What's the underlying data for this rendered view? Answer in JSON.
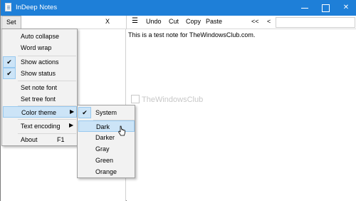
{
  "window": {
    "title": "InDeep Notes"
  },
  "toolbar": {
    "set_label": "Set",
    "close_tree_label": "X",
    "menu_icon": "hamburger-icon",
    "undo_label": "Undo",
    "cut_label": "Cut",
    "copy_label": "Copy",
    "paste_label": "Paste",
    "back2_label": "<<",
    "back_label": "<"
  },
  "note": {
    "text": "This is a test note for TheWindowsClub.com."
  },
  "watermark": {
    "text": "TheWindowsClub"
  },
  "menu": {
    "items": [
      {
        "label": "Auto collapse",
        "checked": false
      },
      {
        "label": "Word wrap",
        "checked": false
      },
      {
        "label": "Show actions",
        "checked": true
      },
      {
        "label": "Show status",
        "checked": true
      },
      {
        "label": "Set note font",
        "checked": false
      },
      {
        "label": "Set tree font",
        "checked": false
      },
      {
        "label": "Color theme",
        "checked": false,
        "submenu": true
      },
      {
        "label": "Text encoding",
        "checked": false,
        "submenu": true
      },
      {
        "label": "About",
        "accelerator": "F1",
        "checked": false
      }
    ],
    "check_glyph": "✔",
    "arrow_glyph": "▶"
  },
  "submenu": {
    "items": [
      {
        "label": "System",
        "checked": true
      },
      {
        "label": "Dark",
        "highlighted": true
      },
      {
        "label": "Darker"
      },
      {
        "label": "Gray"
      },
      {
        "label": "Green"
      },
      {
        "label": "Orange"
      }
    ]
  },
  "colors": {
    "titlebar": "#1e7fd8",
    "highlight": "#cce4f7",
    "highlight_border": "#99c9ef"
  }
}
